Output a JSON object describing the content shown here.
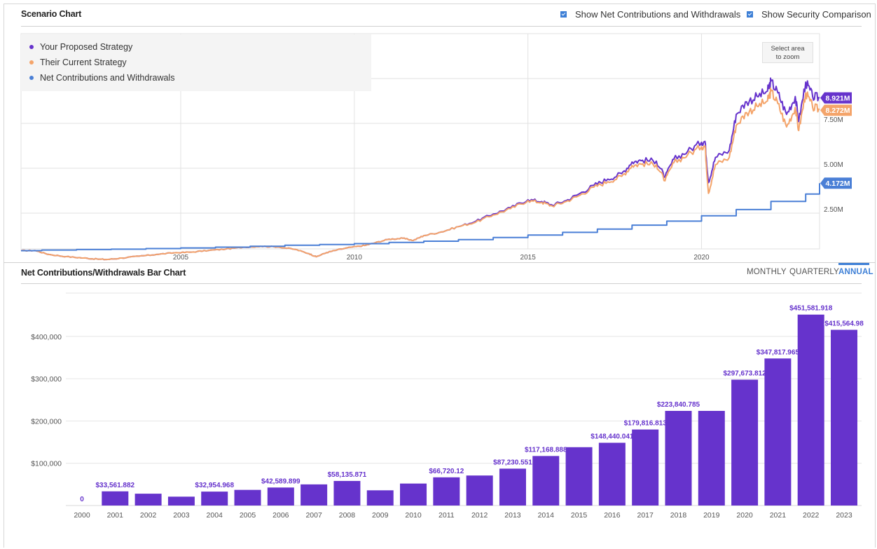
{
  "scenario": {
    "title": "Scenario Chart",
    "options": [
      {
        "label": "Show Net Contributions and Withdrawals",
        "checked": true
      },
      {
        "label": "Show Security Comparison",
        "checked": true
      }
    ],
    "zoom_button": {
      "line1": "Select area",
      "line2": "to zoom"
    }
  },
  "bar_section": {
    "title": "Net Contributions/Withdrawals Bar Chart",
    "frequency_tabs": [
      {
        "label": "MONTHLY",
        "active": false
      },
      {
        "label": "QUARTERLY",
        "active": false
      },
      {
        "label": "ANNUAL",
        "active": true
      }
    ]
  },
  "colors": {
    "proposed": "#6633cc",
    "current": "#f4a46a",
    "contributions": "#4a7fd6",
    "bar": "#6633cc",
    "bar_label": "#6633cc",
    "active_tab": "#3d7fd6"
  },
  "chart_data": [
    {
      "type": "line",
      "title": "Scenario Chart",
      "legend_position": "top-left",
      "legend": [
        "Your Proposed Strategy",
        "Their Current Strategy",
        "Net Contributions and Withdrawals"
      ],
      "x_ticks": [
        "2005",
        "2010",
        "2015",
        "2020"
      ],
      "xlim": [
        2000.4,
        2023.4
      ],
      "y_ticks": [
        "2.50M",
        "5.00M",
        "7.50M"
      ],
      "y_tick_values": [
        2500000,
        5000000,
        7500000
      ],
      "ylim": [
        0,
        12500000
      ],
      "grid": true,
      "end_labels": {
        "proposed": "8.921M",
        "current": "8.272M",
        "contributions": "4.172M"
      },
      "series": [
        {
          "name": "Your Proposed Strategy",
          "x": [
            2000.4,
            2000.8,
            2001.2,
            2001.7,
            2002.2,
            2002.6,
            2002.9,
            2003.3,
            2003.8,
            2004.3,
            2004.8,
            2005.3,
            2005.8,
            2006.3,
            2006.8,
            2007.3,
            2007.8,
            2008.3,
            2008.7,
            2008.9,
            2009.2,
            2009.5,
            2009.9,
            2010.3,
            2010.6,
            2011.0,
            2011.4,
            2011.7,
            2012.0,
            2012.5,
            2013.0,
            2013.5,
            2014.0,
            2014.5,
            2015.0,
            2015.4,
            2015.7,
            2016.1,
            2016.5,
            2016.9,
            2017.3,
            2017.7,
            2018.0,
            2018.3,
            2018.7,
            2018.95,
            2019.2,
            2019.6,
            2020.0,
            2020.1,
            2020.2,
            2020.4,
            2020.8,
            2021.0,
            2021.3,
            2021.6,
            2021.9,
            2022.0,
            2022.2,
            2022.45,
            2022.7,
            2022.8,
            2023.0,
            2023.2,
            2023.4
          ],
          "values": [
            410000,
            420000,
            200000,
            80000,
            0,
            -60000,
            -80000,
            0,
            100000,
            200000,
            290000,
            330000,
            420000,
            500000,
            600000,
            650000,
            620000,
            480000,
            240000,
            70000,
            300000,
            450000,
            600000,
            700000,
            850000,
            1050000,
            1100000,
            980000,
            1250000,
            1450000,
            1750000,
            2050000,
            2450000,
            2800000,
            3250000,
            3150000,
            2950000,
            3200000,
            3600000,
            4050000,
            4400000,
            4700000,
            5350000,
            5450000,
            5400000,
            4500000,
            5500000,
            5950000,
            6450000,
            6500000,
            4200000,
            5600000,
            6000000,
            8000000,
            8700000,
            9000000,
            9300000,
            9850000,
            9200000,
            8000000,
            9000000,
            7600000,
            9800000,
            9000000,
            8921000
          ]
        },
        {
          "name": "Their Current Strategy",
          "x": [
            2000.4,
            2000.8,
            2001.2,
            2001.7,
            2002.2,
            2002.6,
            2002.9,
            2003.3,
            2003.8,
            2004.3,
            2004.8,
            2005.3,
            2005.8,
            2006.3,
            2006.8,
            2007.3,
            2007.8,
            2008.3,
            2008.7,
            2008.9,
            2009.2,
            2009.5,
            2009.9,
            2010.3,
            2010.6,
            2011.0,
            2011.4,
            2011.7,
            2012.0,
            2012.5,
            2013.0,
            2013.5,
            2014.0,
            2014.5,
            2015.0,
            2015.4,
            2015.7,
            2016.1,
            2016.5,
            2016.9,
            2017.3,
            2017.7,
            2018.0,
            2018.3,
            2018.7,
            2018.95,
            2019.2,
            2019.6,
            2020.0,
            2020.1,
            2020.2,
            2020.4,
            2020.8,
            2021.0,
            2021.3,
            2021.6,
            2021.9,
            2022.0,
            2022.2,
            2022.45,
            2022.7,
            2022.8,
            2023.0,
            2023.2,
            2023.4
          ],
          "values": [
            410000,
            420000,
            200000,
            80000,
            0,
            -60000,
            -80000,
            0,
            100000,
            200000,
            290000,
            330000,
            420000,
            500000,
            600000,
            650000,
            620000,
            480000,
            240000,
            70000,
            300000,
            450000,
            600000,
            700000,
            850000,
            1050000,
            1100000,
            980000,
            1250000,
            1450000,
            1750000,
            2000000,
            2400000,
            2750000,
            3200000,
            3100000,
            2900000,
            3150000,
            3500000,
            3950000,
            4250000,
            4550000,
            5150000,
            5250000,
            5200000,
            4300000,
            5300000,
            5750000,
            6200000,
            6250000,
            3600000,
            5200000,
            5600000,
            7400000,
            8100000,
            8450000,
            8750000,
            9300000,
            8600000,
            7300000,
            8400000,
            7100000,
            9200000,
            8400000,
            8272000
          ]
        },
        {
          "name": "Net Contributions and Withdrawals",
          "step": true,
          "x": [
            2000.4,
            2001.0,
            2002.0,
            2003.0,
            2004.0,
            2005.0,
            2006.0,
            2007.0,
            2008.0,
            2009.0,
            2010.0,
            2011.0,
            2012.0,
            2013.0,
            2014.0,
            2015.0,
            2016.0,
            2017.0,
            2018.0,
            2019.0,
            2020.0,
            2021.0,
            2022.0,
            2023.0,
            2023.4
          ],
          "values": [
            410000,
            444000,
            472000,
            494000,
            527000,
            564000,
            606000,
            655000,
            713000,
            750000,
            802000,
            869000,
            938000,
            1025000,
            1142000,
            1279000,
            1428000,
            1608000,
            1831000,
            2055000,
            2353000,
            2701000,
            3152000,
            3568000,
            4172000
          ]
        }
      ]
    },
    {
      "type": "bar",
      "title": "Net Contributions/Withdrawals Bar Chart",
      "categories": [
        "2000",
        "2001",
        "2002",
        "2003",
        "2004",
        "2005",
        "2006",
        "2007",
        "2008",
        "2009",
        "2010",
        "2011",
        "2012",
        "2013",
        "2014",
        "2015",
        "2016",
        "2017",
        "2018",
        "2019",
        "2020",
        "2021",
        "2022",
        "2023"
      ],
      "values": [
        0,
        33561.882,
        28000,
        21000,
        32954.968,
        37000,
        42589.899,
        50000,
        58135.871,
        36000,
        52000,
        66720.12,
        71000,
        87230.551,
        117168.888,
        138000,
        148440.041,
        179816.813,
        223840.785,
        223840.785,
        297673.812,
        347817.965,
        451581.918,
        415564.98
      ],
      "data_labels": [
        "0",
        "$33,561.882",
        "",
        "",
        "$32,954.968",
        "",
        "$42,589.899",
        "",
        "$58,135.871",
        "",
        "",
        "$66,720.12",
        "",
        "$87,230.551",
        "$117,168.888",
        "",
        "$148,440.041",
        "$179,816.813",
        "$223,840.785",
        "",
        "$297,673.812",
        "$347,817.965",
        "$451,581.918",
        "$415,564.98"
      ],
      "y_ticks": [
        "$100,000",
        "$200,000",
        "$300,000",
        "$400,000"
      ],
      "y_tick_values": [
        100000,
        200000,
        300000,
        400000
      ],
      "ylim": [
        0,
        400000
      ],
      "xlabel": "",
      "ylabel": "",
      "grid": true
    }
  ]
}
